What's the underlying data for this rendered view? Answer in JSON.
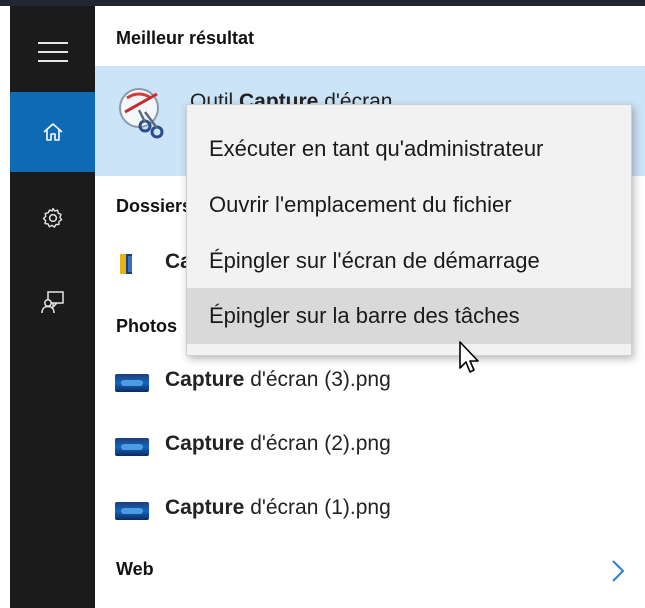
{
  "rail": {
    "items": [
      {
        "name": "hamburger-icon"
      },
      {
        "name": "home-icon",
        "active": true
      },
      {
        "name": "gear-icon"
      },
      {
        "name": "feedback-icon"
      }
    ]
  },
  "panel": {
    "best_result_header": "Meilleur résultat",
    "best_result": {
      "title_prefix": "Outil ",
      "title_bold": "Capture",
      "title_suffix": " d'écran"
    },
    "folders_header": "Dossiers",
    "folder_item": {
      "bold": "Ca"
    },
    "photos_header": "Photos",
    "photos": [
      {
        "bold": "Capture",
        "rest": " d'écran (3).png"
      },
      {
        "bold": "Capture",
        "rest": " d'écran (2).png"
      },
      {
        "bold": "Capture",
        "rest": " d'écran (1).png"
      }
    ],
    "web_label": "Web"
  },
  "context_menu": {
    "items": [
      {
        "label": "Exécuter en tant qu'administrateur"
      },
      {
        "label": "Ouvrir l'emplacement du fichier"
      },
      {
        "label": "Épingler sur l'écran de démarrage"
      },
      {
        "label": "Épingler sur la barre des tâches",
        "hovered": true
      }
    ]
  },
  "colors": {
    "rail_bg": "#1b1b1b",
    "rail_active": "#0d6ab3",
    "best_row_bg": "#cce4f7",
    "menu_bg": "#f2f2f2",
    "menu_hover": "#d9d9d9",
    "web_arrow": "#2a7fd4"
  }
}
